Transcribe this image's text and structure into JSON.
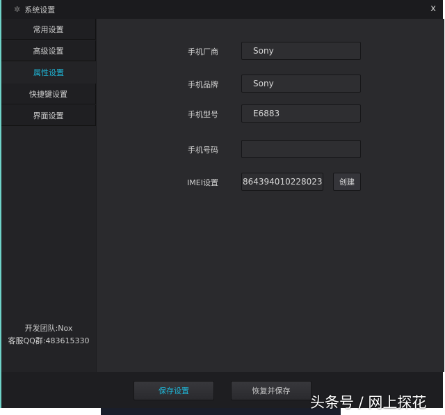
{
  "window": {
    "title": "系统设置",
    "close": "x"
  },
  "sidebar": {
    "items": [
      {
        "label": "常用设置"
      },
      {
        "label": "高级设置"
      },
      {
        "label": "属性设置",
        "active": true
      },
      {
        "label": "快捷键设置"
      },
      {
        "label": "界面设置"
      }
    ],
    "dev_team": "开发团队:Nox",
    "qq_group": "客服QQ群:483615330"
  },
  "form": {
    "manufacturer": {
      "label": "手机厂商",
      "value": "Sony"
    },
    "brand": {
      "label": "手机品牌",
      "value": "Sony"
    },
    "model": {
      "label": "手机型号",
      "value": "E6883"
    },
    "phone": {
      "label": "手机号码",
      "value": ""
    },
    "imei": {
      "label": "IMEI设置",
      "value": "864394010228023",
      "create": "创建"
    }
  },
  "footer": {
    "save": "保存设置",
    "restore": "恢复并保存"
  },
  "watermark": "头条号 / 网上探花",
  "colors": {
    "accent": "#1fb5d6"
  }
}
